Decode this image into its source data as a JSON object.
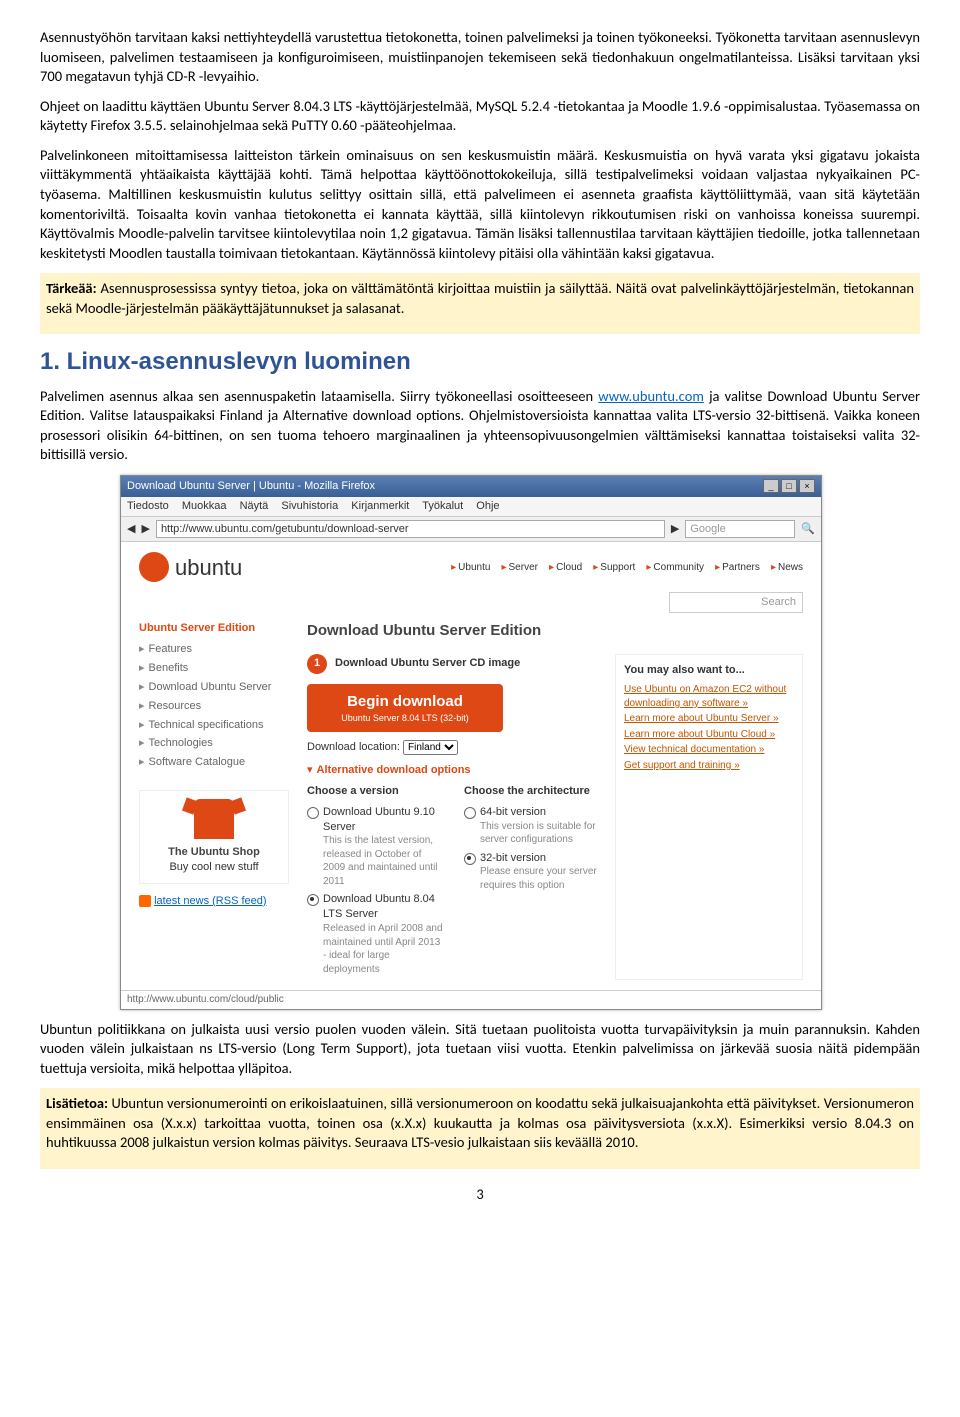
{
  "p1": "Asennustyöhön tarvitaan kaksi nettiyhteydellä varustettua tietokonetta, toinen palvelimeksi ja toinen työkoneeksi. Työkonetta tarvitaan asennuslevyn luomiseen, palvelimen testaamiseen ja konfiguroimiseen, muistiinpanojen tekemiseen sekä tiedonhakuun ongelmatilanteissa. Lisäksi tarvitaan yksi 700 megatavun tyhjä CD-R -levyaihio.",
  "p2": "Ohjeet on laadittu käyttäen Ubuntu Server 8.04.3 LTS -käyttöjärjestelmää, MySQL 5.2.4 -tietokantaa ja Moodle 1.9.6 -oppimisalustaa. Työasemassa on käytetty Firefox 3.5.5. selainohjelmaa sekä PuTTY 0.60 -pääteohjelmaa.",
  "p3": "Palvelinkoneen mitoittamisessa laitteiston tärkein ominaisuus on sen keskusmuistin määrä. Keskusmuistia on hyvä varata yksi gigatavu jokaista viittäkymmentä yhtäaikaista käyttäjää kohti. Tämä helpottaa käyttöönottokokeiluja, sillä testipalvelimeksi voidaan valjastaa nykyaikainen PC-työasema. Maltillinen keskusmuistin kulutus selittyy osittain sillä, että palvelimeen ei asenneta graafista käyttöliittymää, vaan sitä käytetään komentoriviltä. Toisaalta kovin vanhaa tietokonetta ei kannata käyttää, sillä kiintolevyn rikkoutumisen riski on vanhoissa koneissa suurempi. Käyttövalmis Moodle-palvelin tarvitsee kiintolevytilaa noin 1,2 gigatavua. Tämän lisäksi tallennustilaa tarvitaan käyttäjien tiedoille, jotka tallennetaan keskitetysti Moodlen taustalla toimivaan tietokantaan. Käytännössä kiintolevy pitäisi olla vähintään kaksi gigatavua.",
  "hl1a": "Tärkeää:",
  "hl1b": " Asennusprosessissa syntyy tietoa, joka on välttämätöntä kirjoittaa muistiin ja säilyttää. Näitä ovat palvelinkäyttöjärjestelmän, tietokannan sekä Moodle-järjestelmän pääkäyttäjätunnukset ja salasanat.",
  "h1": "1. Linux-asennuslevyn luominen",
  "p4a": "Palvelimen asennus alkaa sen asennuspaketin lataamisella. Siirry työkoneellasi osoitteeseen ",
  "p4link": "www.ubuntu.com",
  "p4b": " ja valitse Download Ubuntu Server Edition. Valitse latauspaikaksi Finland ja Alternative download options. Ohjelmistoversioista kannattaa valita LTS-versio 32-bittisenä. Vaikka koneen prosessori olisikin 64-bittinen, on sen tuoma tehoero marginaalinen ja yhteensopivuusongelmien välttämiseksi kannattaa toistaiseksi valita 32-bittisillä versio.",
  "p5": "Ubuntun politiikkana on julkaista uusi versio puolen vuoden välein. Sitä tuetaan puolitoista vuotta turvapäivityksin ja muin parannuksin. Kahden vuoden välein julkaistaan ns LTS-versio (Long Term Support), jota tuetaan viisi vuotta. Etenkin palvelimissa on järkevää suosia näitä pidempään tuettuja versioita, mikä helpottaa ylläpitoa.",
  "hl2a": "Lisätietoa:",
  "hl2b": " Ubuntun versionumerointi on erikoislaatuinen, sillä versionumeroon on koodattu sekä julkaisuajankohta että päivitykset. Versionumeron ensimmäinen osa (X.x.x) tarkoittaa vuotta, toinen osa (x.X.x) kuukautta ja kolmas osa päivitysversiota (x.x.X). Esimerkiksi versio 8.04.3 on huhtikuussa 2008 julkaistun version kolmas päivitys. Seuraava LTS-vesio julkaistaan siis keväällä 2010.",
  "pagenum": "3",
  "shot": {
    "title": "Download Ubuntu Server | Ubuntu - Mozilla Firefox",
    "menu": [
      "Tiedosto",
      "Muokkaa",
      "Näytä",
      "Sivuhistoria",
      "Kirjanmerkit",
      "Työkalut",
      "Ohje"
    ],
    "url": "http://www.ubuntu.com/getubuntu/download-server",
    "google": "Google",
    "brand": "ubuntu",
    "nav": [
      "Ubuntu",
      "Server",
      "Cloud",
      "Support",
      "Community",
      "Partners",
      "News"
    ],
    "search": "Search",
    "side_head": "Ubuntu Server Edition",
    "sidebar": [
      "Features",
      "Benefits",
      "Download Ubuntu Server",
      "Resources",
      "Technical specifications",
      "Technologies",
      "Software Catalogue"
    ],
    "shop_title": "The Ubuntu Shop",
    "shop_sub": "Buy cool new stuff",
    "rss": "latest news (RSS feed)",
    "main_h": "Download Ubuntu Server Edition",
    "step1": "Download Ubuntu Server CD image",
    "step1_num": "1",
    "btn_big": "Begin download",
    "btn_small": "Ubuntu Server 8.04 LTS (32-bit)",
    "dlloc_label": "Download location:",
    "dlloc_val": "Finland",
    "alt": "Alternative download options",
    "col1_h": "Choose a version",
    "opt1": "Download Ubuntu 9.10 Server",
    "opt1_sub": "This is the latest version, released in October of 2009 and maintained until 2011",
    "opt2": "Download Ubuntu 8.04 LTS Server",
    "opt2_sub": "Released in April 2008 and maintained until April 2013 - ideal for large deployments",
    "col2_h": "Choose the architecture",
    "opt3": "64-bit version",
    "opt3_sub": "This version is suitable for server configurations",
    "opt4": "32-bit version",
    "opt4_sub": "Please ensure your server requires this option",
    "box_h": "You may also want to...",
    "box1": "Use Ubuntu on Amazon EC2 without downloading any software »",
    "box2": "Learn more about Ubuntu Server »",
    "box3": "Learn more about Ubuntu Cloud »",
    "box4": "View technical documentation »",
    "box5": "Get support and training »",
    "status": "http://www.ubuntu.com/cloud/public"
  }
}
